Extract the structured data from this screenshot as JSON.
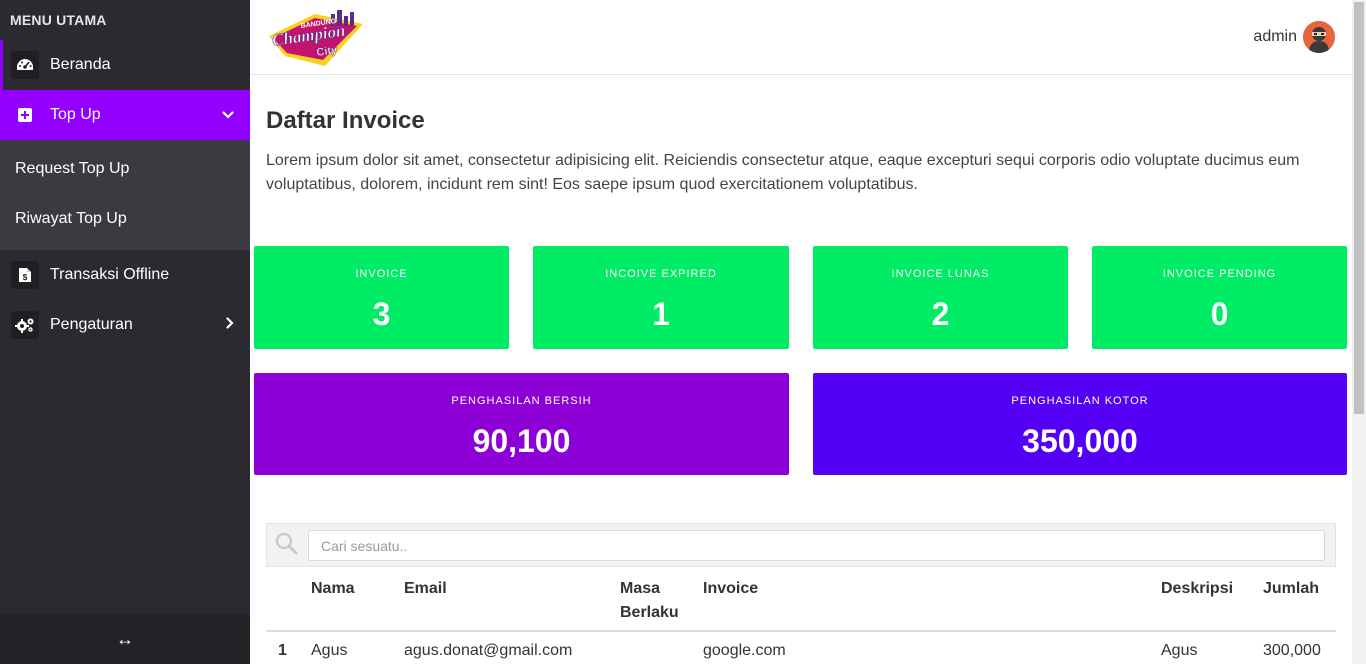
{
  "sidebar": {
    "menu_title": "MENU UTAMA",
    "items": [
      {
        "label": "Beranda",
        "icon": "tachometer-icon"
      },
      {
        "label": "Top Up",
        "icon": "plus-square-icon"
      },
      {
        "label": "Transaksi Offline",
        "icon": "file-invoice-dollar-icon"
      },
      {
        "label": "Pengaturan",
        "icon": "cogs-icon"
      }
    ],
    "submenu": [
      {
        "label": "Request Top Up"
      },
      {
        "label": "Riwayat Top Up"
      }
    ],
    "footer_icon": "↔"
  },
  "header": {
    "logo_text": [
      "BANDUNG",
      "Champion",
      "City"
    ],
    "user_name": "admin"
  },
  "main": {
    "title": "Daftar Invoice",
    "description": "Lorem ipsum dolor sit amet, consectetur adipisicing elit. Reiciendis consectetur atque, eaque excepturi sequi corporis odio voluptate ducimus eum voluptatibus, dolorem, incidunt rem sint! Eos saepe ipsum quod exercitationem voluptatibus.",
    "cards": [
      {
        "label": "INVOICE",
        "value": "3"
      },
      {
        "label": "INCOIVE EXPIRED",
        "value": "1"
      },
      {
        "label": "INVOICE LUNAS",
        "value": "2"
      },
      {
        "label": "INVOICE PENDING",
        "value": "0"
      },
      {
        "label": "PENGHASILAN BERSIH",
        "value": "90,100"
      },
      {
        "label": "PENGHASILAN KOTOR",
        "value": "350,000"
      }
    ],
    "search": {
      "placeholder": "Cari sesuatu.."
    },
    "table": {
      "headers": [
        "Nama",
        "Email",
        "Masa Berlaku",
        "Invoice",
        "Deskripsi",
        "Jumlah"
      ],
      "rows": [
        {
          "no": "1",
          "nama": "Agus",
          "email": "agus.donat@gmail.com",
          "masa": "",
          "invoice": "google.com",
          "deskripsi": "Agus",
          "jumlah": "300,000"
        }
      ]
    }
  },
  "colors": {
    "accent": "#9400ff",
    "green_card": "#00ec64",
    "purple_card": "#8c00d6",
    "violet_card": "#5400f5",
    "sidebar_bg": "#2b2a30"
  }
}
